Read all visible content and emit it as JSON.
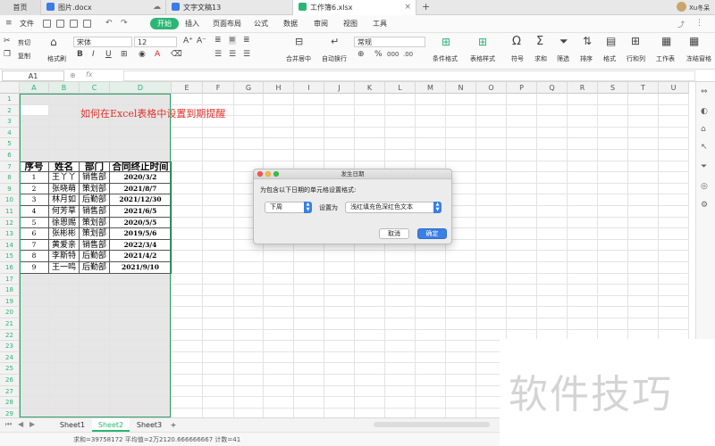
{
  "tabs": [
    {
      "label": "首页"
    },
    {
      "label": "图片.docx"
    },
    {
      "label": "文字文稿13"
    },
    {
      "label": "工作簿6.xlsx"
    }
  ],
  "user_name": "Xu冬呆",
  "menu": [
    "文件",
    "开始",
    "插入",
    "页面布局",
    "公式",
    "数据",
    "审阅",
    "视图",
    "工具"
  ],
  "ribbon": {
    "cut": "剪切",
    "copy": "复制",
    "format_painter": "格式刷",
    "font_name": "宋体",
    "font_size": "12",
    "number_format": "常规",
    "merge": "合并居中",
    "wrap": "自动换行",
    "cond_format": "条件格式",
    "table_style": "表格样式",
    "symbol": "符号",
    "sum": "求和",
    "filter": "筛选",
    "sort": "排序",
    "format": "格式",
    "rowcol": "行和列",
    "worksheet": "工作表",
    "freeze": "冻结窗格"
  },
  "formula_bar": {
    "name_box": "A1",
    "fx": "fx",
    "content": ""
  },
  "columns": [
    "A",
    "B",
    "C",
    "D",
    "E",
    "F",
    "G",
    "H",
    "I",
    "J",
    "K",
    "L",
    "M",
    "N",
    "O",
    "P",
    "Q",
    "R",
    "S",
    "T",
    "U"
  ],
  "sheet_title": "如何在Excel表格中设置到期提醒",
  "table": {
    "headers": [
      "序号",
      "姓名",
      "部门",
      "合同终止时间"
    ],
    "rows": [
      [
        "1",
        "王丫丫",
        "销售部",
        "2020/3/2"
      ],
      [
        "2",
        "张晓萌",
        "策划部",
        "2021/8/7"
      ],
      [
        "3",
        "林月如",
        "后勤部",
        "2021/12/30"
      ],
      [
        "4",
        "何芳草",
        "销售部",
        "2021/6/5"
      ],
      [
        "5",
        "徐恩赐",
        "策划部",
        "2020/5/5"
      ],
      [
        "6",
        "张彬彬",
        "策划部",
        "2019/5/6"
      ],
      [
        "7",
        "黄爱亲",
        "销售部",
        "2022/3/4"
      ],
      [
        "8",
        "李斯特",
        "后勤部",
        "2021/4/2"
      ],
      [
        "9",
        "王一鸣",
        "后勤部",
        "2021/9/10"
      ]
    ]
  },
  "dialog": {
    "title": "发生日期",
    "prompt": "为包含以下日期的单元格设置格式:",
    "period": "下周",
    "set_as_label": "设置为",
    "style": "浅红填充色深红色文本",
    "cancel": "取消",
    "ok": "确定"
  },
  "sheets": [
    "Sheet1",
    "Sheet2",
    "Sheet3"
  ],
  "add_sheet": "+",
  "status": "求和=39758172  平均值=2万2120.666666667  计数=41",
  "watermark": "软件技巧",
  "colors": {
    "accent": "#2bb673",
    "title_red": "#e0302a",
    "dialog_blue": "#3a7fe3"
  }
}
